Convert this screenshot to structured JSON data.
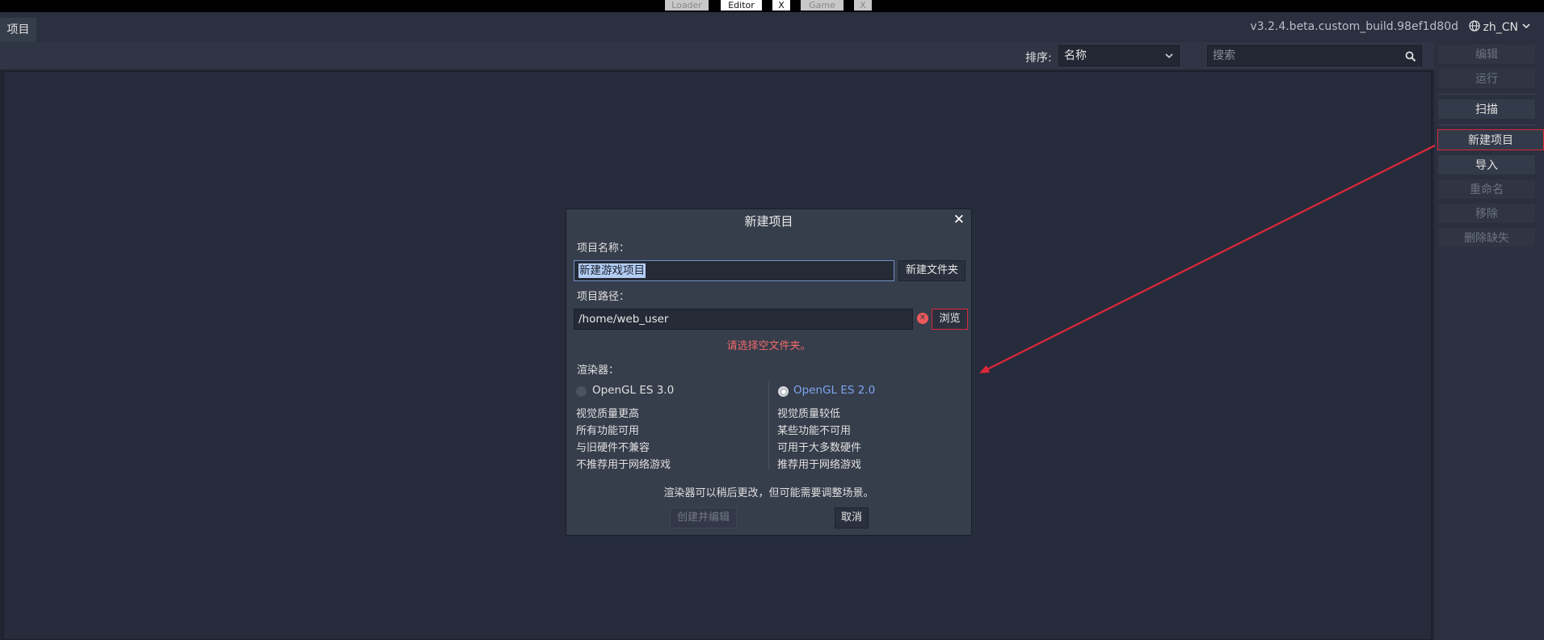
{
  "topbar": {
    "tabs": [
      {
        "label": "Loader"
      },
      {
        "label": "Editor"
      },
      {
        "label": "X"
      },
      {
        "label": "Game"
      },
      {
        "label": "X"
      }
    ]
  },
  "header": {
    "project_tab": "项目",
    "version": "v3.2.4.beta.custom_build.98ef1d80d",
    "language": "zh_CN"
  },
  "toolbar": {
    "sort_label": "排序:",
    "sort_value": "名称",
    "search_placeholder": "搜索"
  },
  "sidebar": {
    "edit": "编辑",
    "run": "运行",
    "scan": "扫描",
    "new_project": "新建项目",
    "import": "导入",
    "rename": "重命名",
    "remove": "移除",
    "remove_missing": "删除缺失"
  },
  "dialog": {
    "title": "新建项目",
    "name_label": "项目名称：",
    "name_value": "新建游戏项目",
    "create_folder": "新建文件夹",
    "path_label": "项目路径：",
    "path_value": "/home/web_user",
    "browse": "浏览",
    "error": "请选择空文件夹。",
    "renderer_label": "渲染器：",
    "gles3": {
      "label": "OpenGL ES 3.0",
      "features": [
        "视觉质量更高",
        "所有功能可用",
        "与旧硬件不兼容",
        "不推荐用于网络游戏"
      ]
    },
    "gles2": {
      "label": "OpenGL ES 2.0",
      "features": [
        "视觉质量较低",
        "某些功能不可用",
        "可用于大多数硬件",
        "推荐用于网络游戏"
      ]
    },
    "renderer_note": "渲染器可以稍后更改，但可能需要调整场景。",
    "create_edit": "创建并编辑",
    "cancel": "取消"
  },
  "colors": {
    "accent": "#6f8fc7",
    "error": "#f06a6a",
    "annotation": "#e0263a",
    "selected_renderer": "#7ea7ef"
  }
}
